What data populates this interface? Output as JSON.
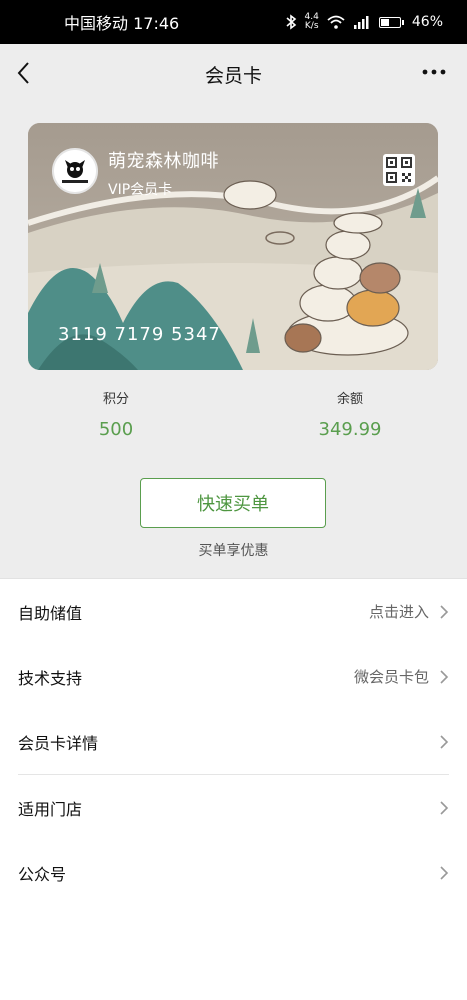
{
  "status_bar": {
    "carrier_time": "中国移动 17:46",
    "net_speed_top": "4.4",
    "net_speed_bottom": "K/s",
    "signal_type": "4G",
    "battery_percent": "46%",
    "battery_level": 0.46
  },
  "nav": {
    "title": "会员卡",
    "back_icon": "chevron-left-icon",
    "more_icon": "more-dots-icon"
  },
  "card": {
    "brand_name": "萌宠森林咖啡",
    "tier": "VIP会员卡",
    "card_number": "3119 7179 5347",
    "logo_icon": "cat-logo-icon",
    "qr_icon": "qr-code-icon",
    "colors": {
      "top": "#a59b8f",
      "bottom": "#d8d2c4",
      "mountain": "#4f8e88"
    }
  },
  "stats": {
    "points_label": "积分",
    "points_value": "500",
    "balance_label": "余额",
    "balance_value": "349.99"
  },
  "quick_buy": {
    "label": "快速买单",
    "subtitle": "买单享优惠"
  },
  "menu": [
    {
      "label": "自助储值",
      "value": "点击进入"
    },
    {
      "label": "技术支持",
      "value": "微会员卡包"
    },
    {
      "label": "会员卡详情",
      "value": ""
    },
    {
      "label": "适用门店",
      "value": ""
    },
    {
      "label": "公众号",
      "value": ""
    }
  ],
  "colors": {
    "accent": "#5a9e4e",
    "nav_bg": "#ededed",
    "status_bg": "#000000"
  }
}
